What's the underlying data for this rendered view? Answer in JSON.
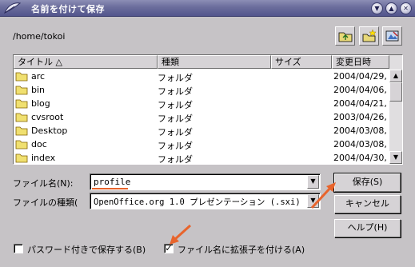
{
  "window": {
    "title": "名前を付けて保存",
    "controls": [
      "▼",
      "▲",
      "✕"
    ]
  },
  "location": {
    "path": "/home/tokoi"
  },
  "toolbar": {
    "buttons": [
      "up-folder-icon",
      "new-folder-icon",
      "default-folder-icon"
    ]
  },
  "file_list": {
    "columns": [
      "タイトル △",
      "種類",
      "サイズ",
      "変更日時"
    ],
    "rows": [
      {
        "name": "arc",
        "type": "フォルダ",
        "size": "",
        "modified": "2004/04/29, "
      },
      {
        "name": "bin",
        "type": "フォルダ",
        "size": "",
        "modified": "2004/04/06, "
      },
      {
        "name": "blog",
        "type": "フォルダ",
        "size": "",
        "modified": "2004/04/21, "
      },
      {
        "name": "cvsroot",
        "type": "フォルダ",
        "size": "",
        "modified": "2003/04/26, "
      },
      {
        "name": "Desktop",
        "type": "フォルダ",
        "size": "",
        "modified": "2004/03/08, "
      },
      {
        "name": "doc",
        "type": "フォルダ",
        "size": "",
        "modified": "2004/03/08, "
      },
      {
        "name": "index",
        "type": "フォルダ",
        "size": "",
        "modified": "2004/04/30, "
      }
    ]
  },
  "form": {
    "filename_label": "ファイル名(N):",
    "filename_value": "profile",
    "filetype_label": "ファイルの種類(",
    "filetype_value": "OpenOffice.org 1.0 プレゼンテーション (.sxi)"
  },
  "buttons": {
    "save": "保存(S)",
    "cancel": "キャンセル",
    "help": "ヘルプ(H)"
  },
  "options": {
    "password_label": "パスワード付きで保存する(B)",
    "password_checked": false,
    "extension_label": "ファイル名に拡張子を付ける(A)",
    "extension_checked": true
  },
  "colors": {
    "annotation_arrow": "#e8642c",
    "window_bg": "#c6c3c6",
    "titlebar": "#6b6d9c"
  }
}
